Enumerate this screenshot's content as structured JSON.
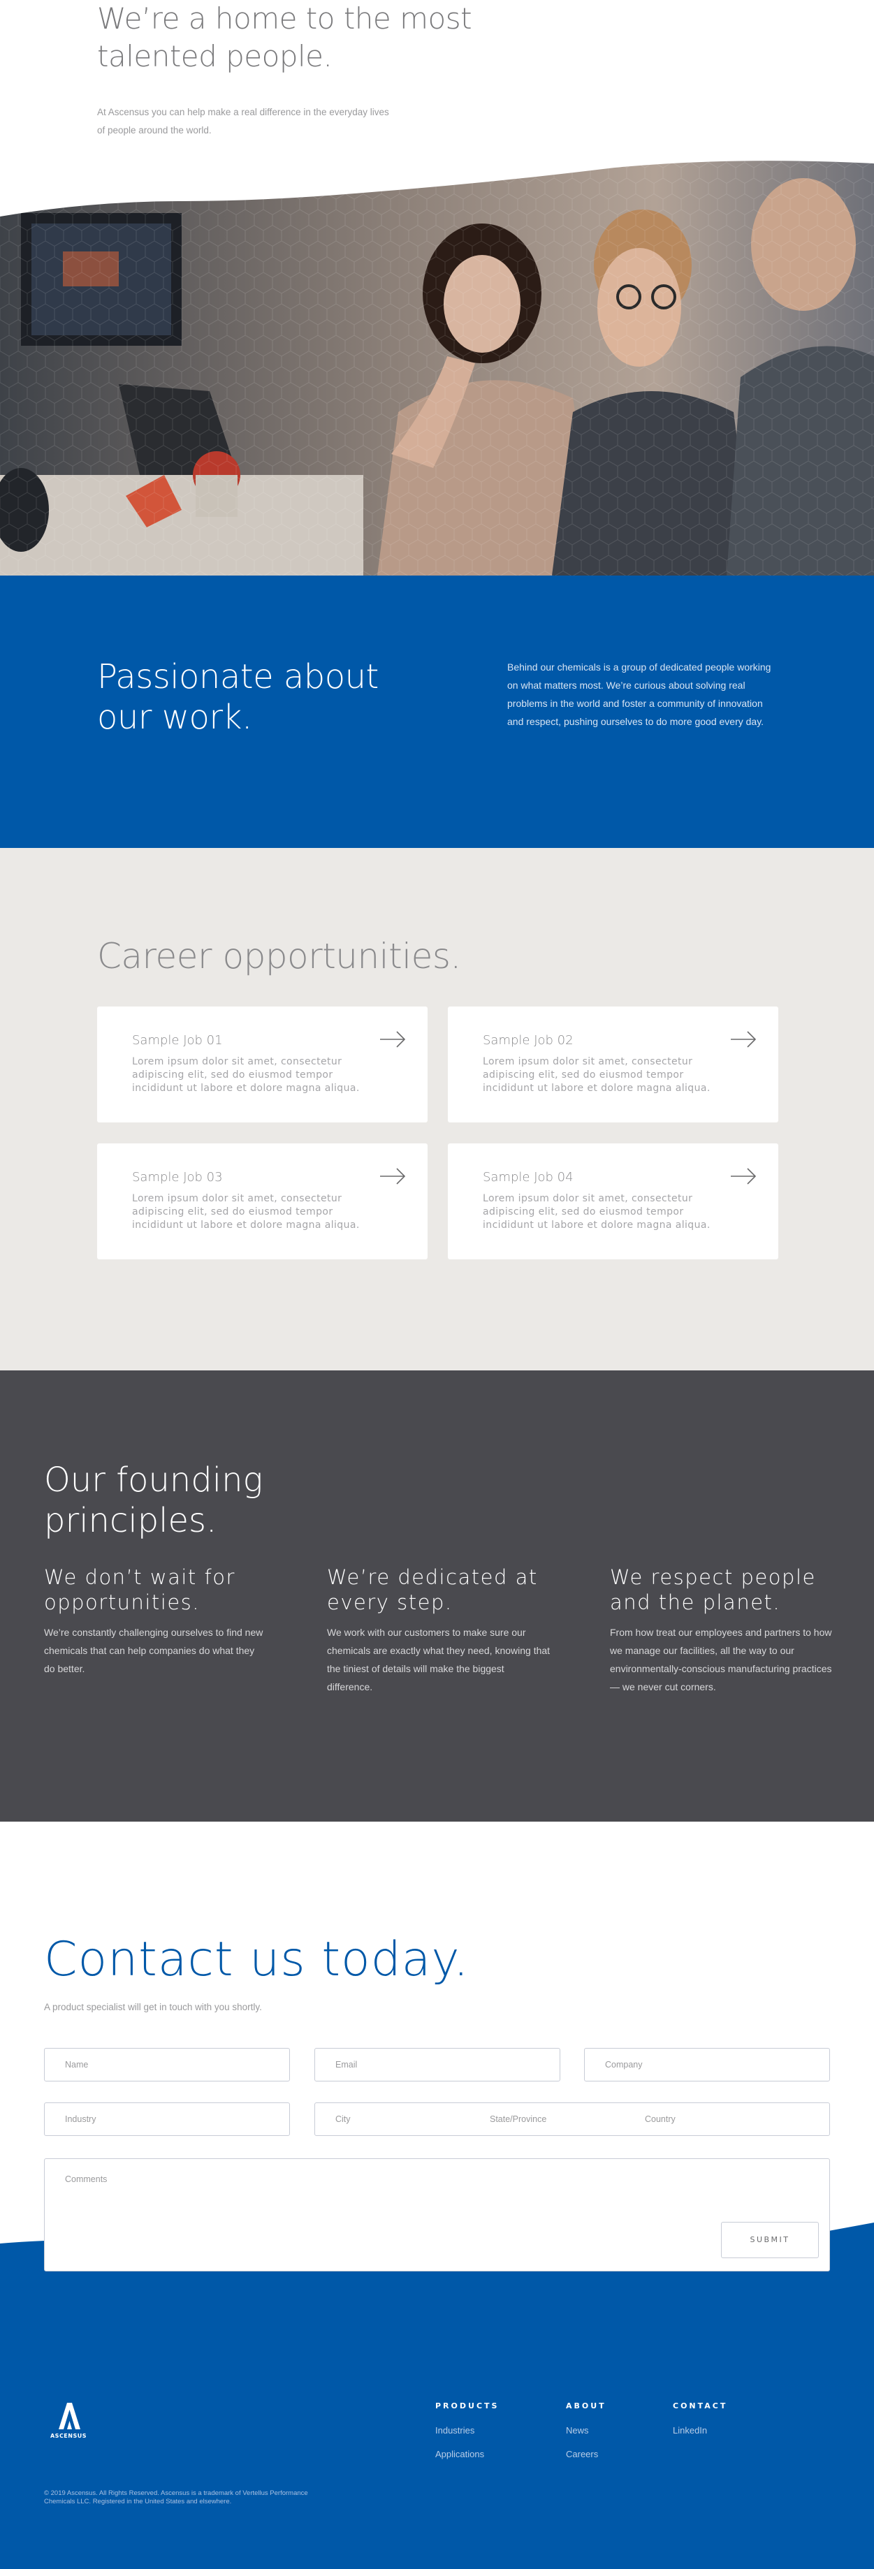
{
  "hero": {
    "title": "We’re a home to the most talented people.",
    "text": "At Ascensus you can help make a real difference in the everyday lives of people around the world."
  },
  "passion": {
    "title": "Passionate about our work.",
    "text": "Behind our chemicals is a group of dedicated people working on what matters most. We’re curious about solving real problems in the world and foster a community of innovation and respect, pushing ourselves to do more good every day."
  },
  "careers": {
    "title": "Career opportunities.",
    "jobs": [
      {
        "title": "Sample Job 01",
        "desc": "Lorem ipsum dolor sit amet, consectetur adipiscing elit, sed do eiusmod tempor incididunt ut labore et dolore magna aliqua."
      },
      {
        "title": "Sample Job 02",
        "desc": "Lorem ipsum dolor sit amet, consectetur adipiscing elit, sed do eiusmod tempor incididunt ut labore et dolore magna aliqua."
      },
      {
        "title": "Sample Job 03",
        "desc": "Lorem ipsum dolor sit amet, consectetur adipiscing elit, sed do eiusmod tempor incididunt ut labore et dolore magna aliqua."
      },
      {
        "title": "Sample Job 04",
        "desc": "Lorem ipsum dolor sit amet, consectetur adipiscing elit, sed do eiusmod tempor incididunt ut labore et dolore magna aliqua."
      }
    ],
    "arrow_icon": "arrow-right-icon"
  },
  "principles": {
    "title": "Our founding principles.",
    "items": [
      {
        "title": "We don’t wait for opportunities.",
        "text": "We’re constantly challenging ourselves to find new chemicals that can help companies do what they do better."
      },
      {
        "title": "We’re dedicated at every step.",
        "text": "We work with our customers to make sure our chemicals are exactly what they need, knowing that the tiniest of details will make the biggest difference."
      },
      {
        "title": "We respect people and the planet.",
        "text": "From how treat our employees and partners to how we manage our facilities, all the way to our environmentally-conscious manufacturing practices — we never cut corners."
      }
    ]
  },
  "contact": {
    "title": "Contact us today.",
    "subtitle": "A product specialist will get in touch with you shortly.",
    "fields": {
      "name": "Name",
      "email": "Email",
      "company": "Company",
      "industry": "Industry",
      "city": "City",
      "state": "State/Province",
      "country": "Country",
      "comments": "Comments"
    },
    "submit": "SUBMIT"
  },
  "footer": {
    "logo_text": "ASCENSUS",
    "columns": [
      {
        "heading": "PRODUCTS",
        "links": [
          "Industries",
          "Applications"
        ]
      },
      {
        "heading": "ABOUT",
        "links": [
          "News",
          "Careers"
        ]
      },
      {
        "heading": "CONTACT",
        "links": [
          "LinkedIn"
        ]
      }
    ],
    "copyright": "© 2019 Ascensus. All Rights Reserved. Ascensus is a trademark of Vertellus Performance Chemicals LLC. Registered in the United States and elsewhere."
  },
  "colors": {
    "brand_blue": "#0058a8",
    "dark_gray": "#4a4a4f",
    "light_bg": "#ebe9e6"
  }
}
